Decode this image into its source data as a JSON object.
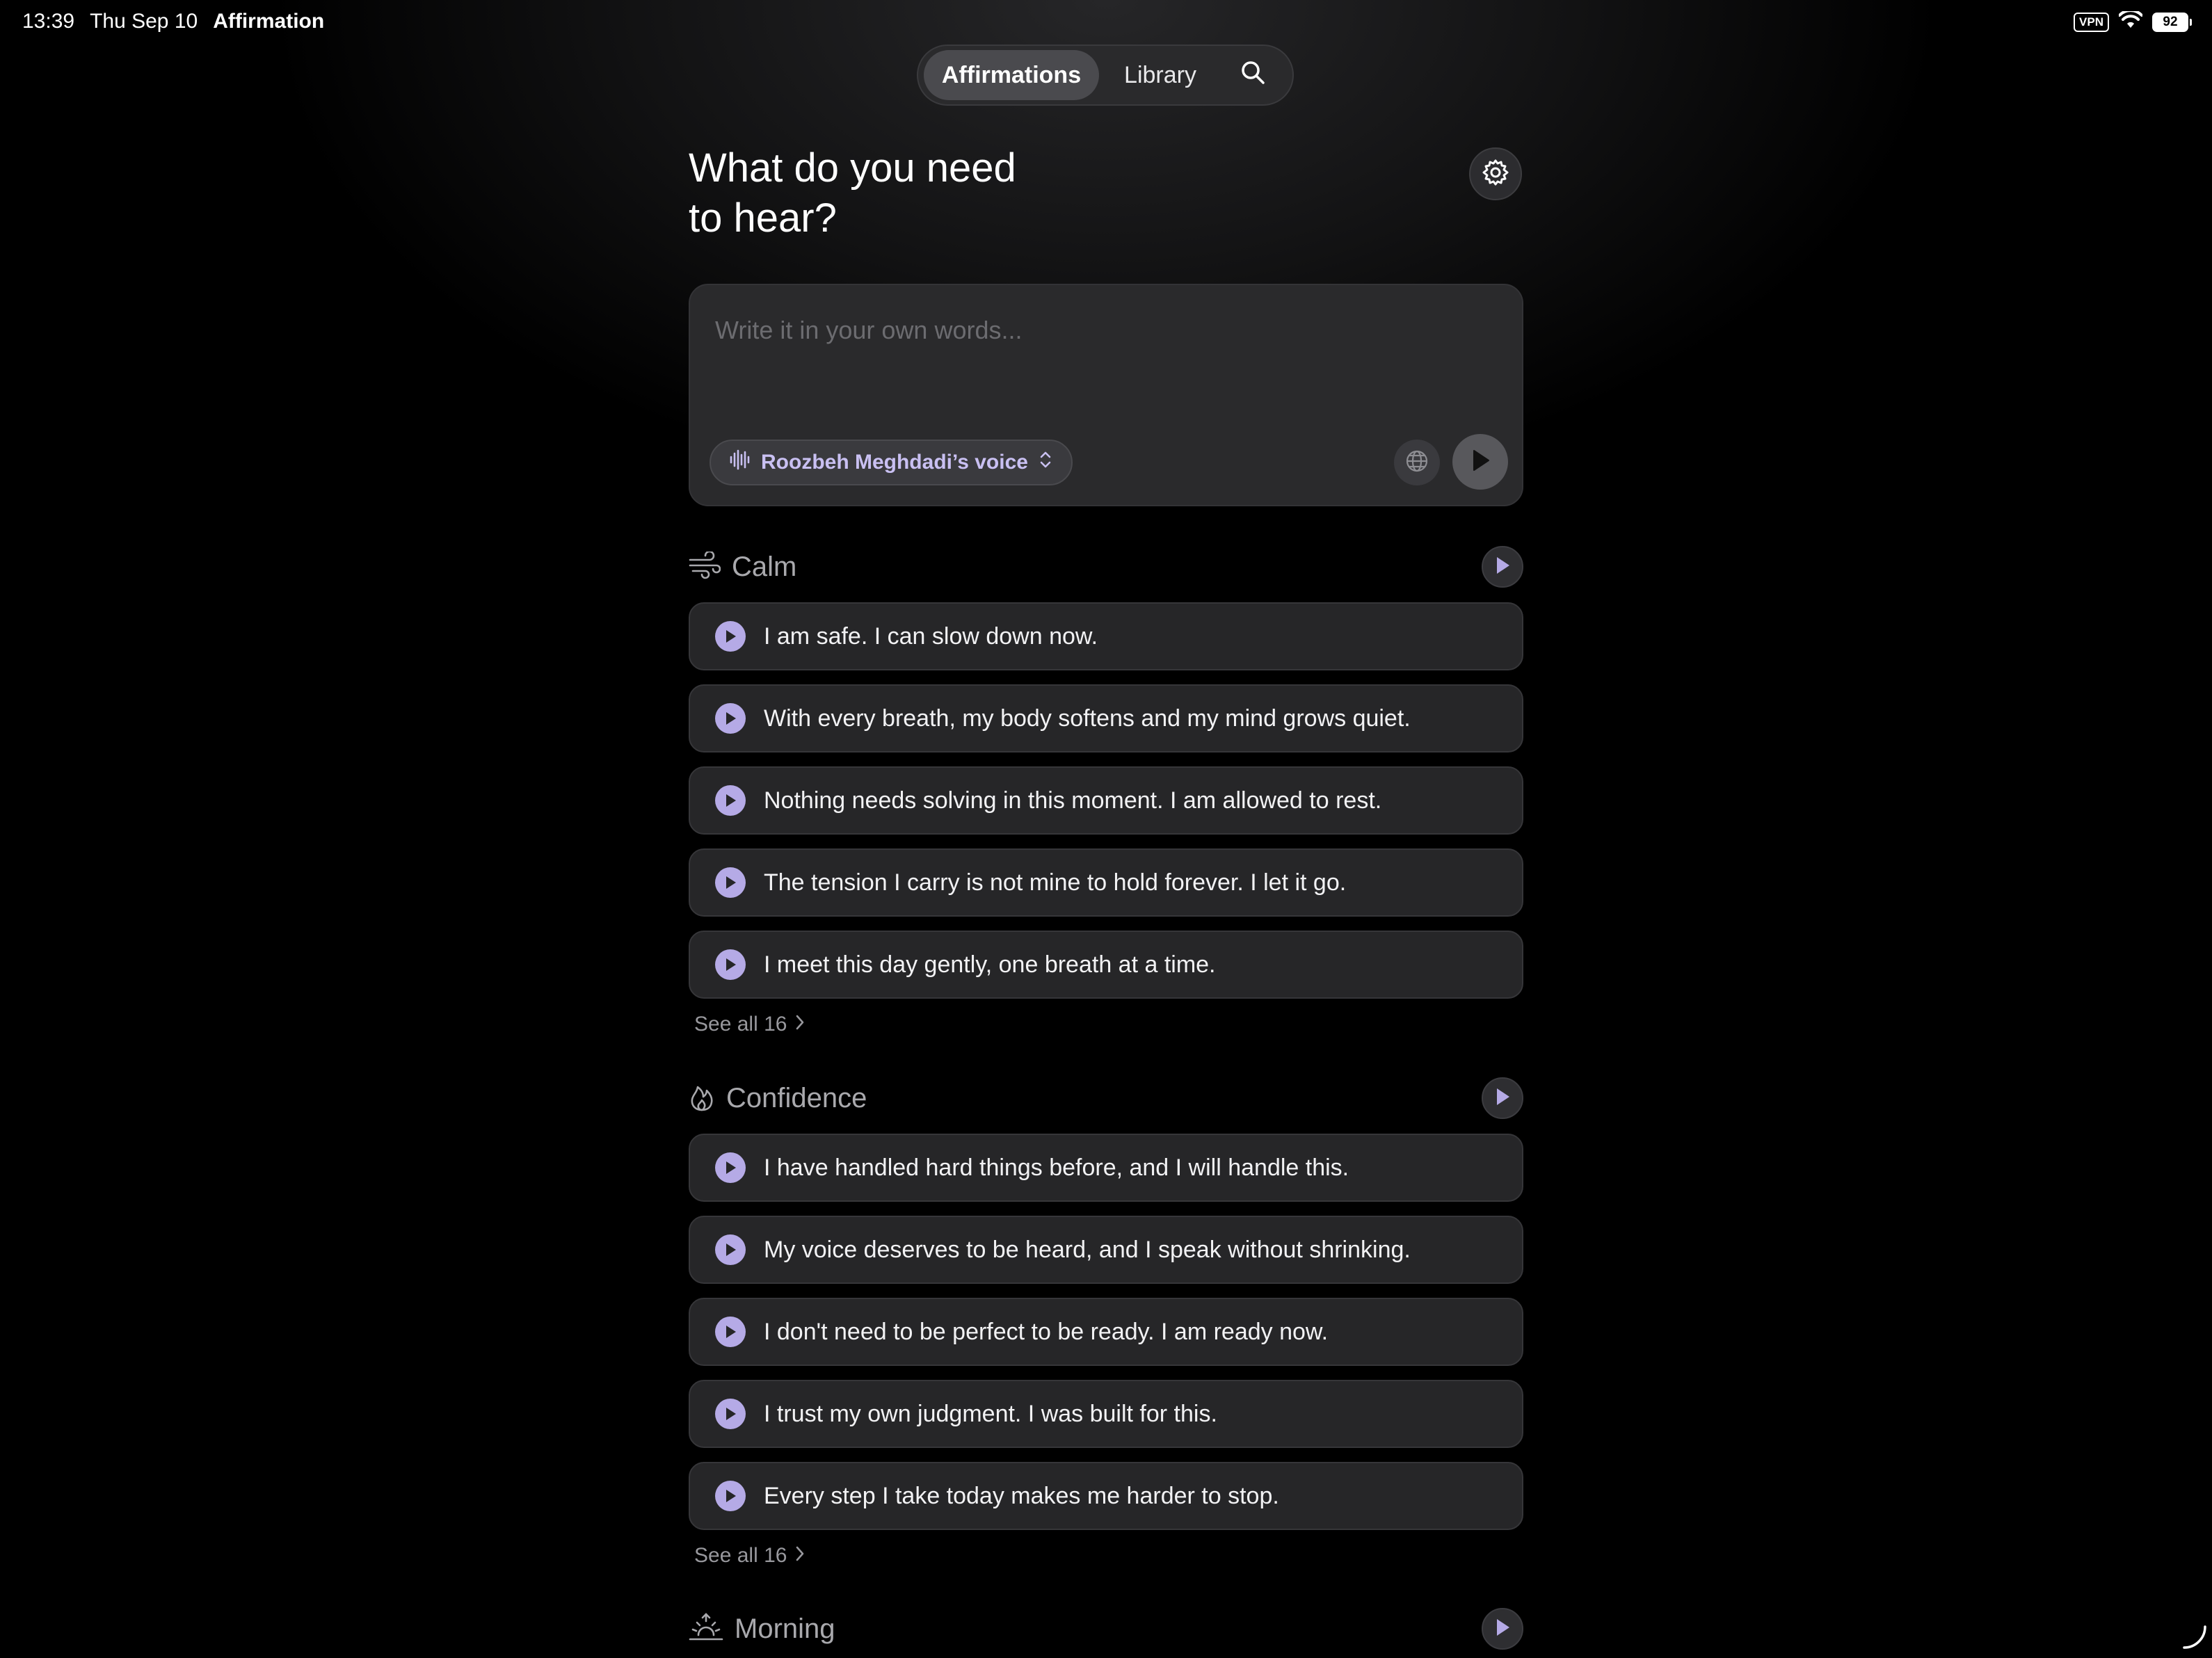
{
  "status_bar": {
    "time": "13:39",
    "date": "Thu Sep 10",
    "app_name": "Affirmation",
    "vpn": "VPN",
    "battery": "92"
  },
  "nav": {
    "tab_affirmations": "Affirmations",
    "tab_library": "Library",
    "search_icon": "search-icon"
  },
  "header": {
    "title_line1": "What do you need",
    "title_line2": "to hear?",
    "settings_icon": "gear-icon"
  },
  "composer": {
    "placeholder": "Write it in your own words...",
    "value": "",
    "voice_label": "Roozbeh Meghdadi’s voice"
  },
  "sections": [
    {
      "title": "Calm",
      "icon": "wind-icon",
      "items": [
        "I am safe. I can slow down now.",
        "With every breath, my body softens and my mind grows quiet.",
        "Nothing needs solving in this moment. I am allowed to rest.",
        "The tension I carry is not mine to hold forever. I let it go.",
        "I meet this day gently, one breath at a time."
      ],
      "see_all": "See all 16"
    },
    {
      "title": "Confidence",
      "icon": "flame-icon",
      "items": [
        "I have handled hard things before, and I will handle this.",
        "My voice deserves to be heard, and I speak without shrinking.",
        "I don't need to be perfect to be ready. I am ready now.",
        "I trust my own judgment. I was built for this.",
        "Every step I take today makes me harder to stop."
      ],
      "see_all": "See all 16"
    },
    {
      "title": "Morning",
      "icon": "sunrise-icon",
      "items": [],
      "see_all": ""
    }
  ],
  "colors": {
    "accent": "#b5aae6",
    "voice_text": "#c9c0f2",
    "card_bg": "#262628",
    "background": "#000000"
  }
}
